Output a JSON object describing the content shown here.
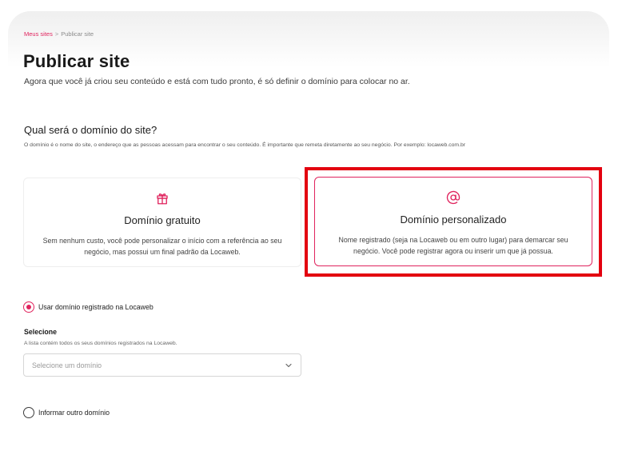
{
  "breadcrumb": {
    "parent": "Meus sites",
    "separator": ">",
    "current": "Publicar site"
  },
  "header": {
    "title": "Publicar site",
    "subtitle": "Agora que você já criou seu conteúdo e está com tudo pronto, é só definir o domínio para colocar no ar."
  },
  "domain_section": {
    "title": "Qual será o domínio do site?",
    "description": "O domínio é o nome do site, o endereço que as pessoas acessam para encontrar o seu conteúdo. É importante que remeta diretamente ao seu negócio. Por exemplo: locaweb.com.br"
  },
  "options": [
    {
      "icon": "gift-icon",
      "title": "Domínio gratuito",
      "description": "Sem nenhum custo, você pode personalizar o início com a referência ao seu negócio, mas possui um final padrão da Locaweb.",
      "selected": false
    },
    {
      "icon": "at-sign-icon",
      "title": "Domínio personalizado",
      "description": "Nome registrado (seja na Locaweb ou em outro lugar) para demarcar seu negócio. Você pode registrar agora ou inserir um que já possua.",
      "selected": true
    }
  ],
  "radio_options": {
    "registered": {
      "label": "Usar domínio registrado na Locaweb",
      "checked": true
    },
    "other": {
      "label": "Informar outro domínio",
      "checked": false
    }
  },
  "select": {
    "label": "Selecione",
    "help": "A lista contém todos os seus domínios registrados na Locaweb.",
    "placeholder": "Selecione um domínio"
  },
  "colors": {
    "accent": "#e0245e",
    "highlight": "#e3000f"
  }
}
